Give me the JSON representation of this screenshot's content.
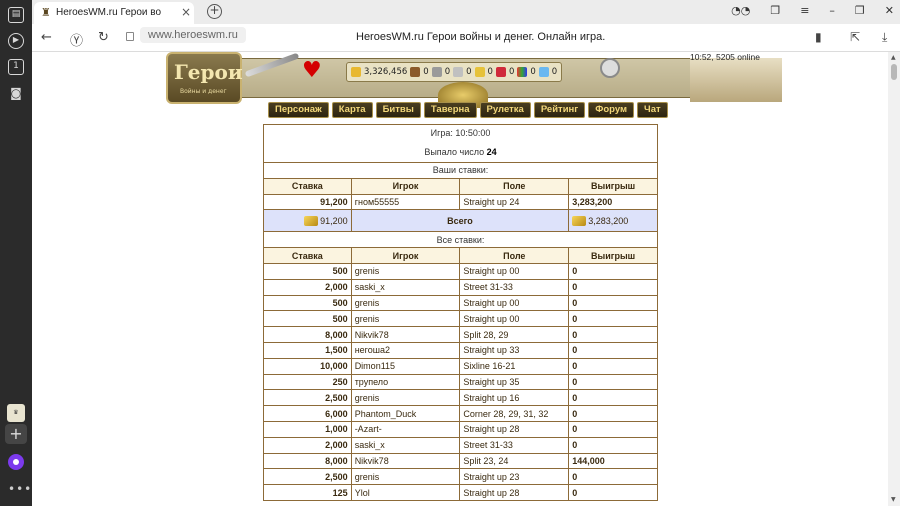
{
  "browser": {
    "tab_title": "HeroesWM.ru Герои во",
    "url": "www.heroeswm.ru",
    "page_title": "HeroesWM.ru Герои войны и денег. Онлайн игра."
  },
  "sidebar": {
    "tab_count": "1"
  },
  "header": {
    "logo_text": "Герои",
    "logo_sub": "Войны и денег",
    "gold": "3,326,456",
    "resources": [
      "0",
      "0",
      "0",
      "0",
      "0",
      "0",
      "0"
    ],
    "time_online": "10:52, 5205 online",
    "nav": [
      "Персонаж",
      "Карта",
      "Битвы",
      "Таверна",
      "Рулетка",
      "Рейтинг",
      "Форум",
      "Чат"
    ]
  },
  "game": {
    "game_label": "Игра: 10:50:00",
    "dropped_prefix": "Выпало число",
    "dropped_number": "24",
    "your_bets_caption": "Ваши ставки:",
    "all_bets_caption": "Все ставки:",
    "columns": [
      "Ставка",
      "Игрок",
      "Поле",
      "Выигрыш"
    ],
    "your_bets": [
      {
        "stake": "91,200",
        "player": "гном55555",
        "field": "Straight up 24",
        "win": "3,283,200"
      }
    ],
    "total": {
      "stake": "91,200",
      "label": "Всего",
      "win": "3,283,200"
    },
    "all_bets": [
      {
        "stake": "500",
        "player": "grenis",
        "field": "Straight up 00",
        "win": "0"
      },
      {
        "stake": "2,000",
        "player": "saski_x",
        "field": "Street 31-33",
        "win": "0"
      },
      {
        "stake": "500",
        "player": "grenis",
        "field": "Straight up 00",
        "win": "0"
      },
      {
        "stake": "500",
        "player": "grenis",
        "field": "Straight up 00",
        "win": "0"
      },
      {
        "stake": "8,000",
        "player": "Nikvik78",
        "field": "Split 28, 29",
        "win": "0"
      },
      {
        "stake": "1,500",
        "player": "негоша2",
        "field": "Straight up 33",
        "win": "0"
      },
      {
        "stake": "10,000",
        "player": "Dimon115",
        "field": "Sixline 16-21",
        "win": "0"
      },
      {
        "stake": "250",
        "player": "трупело",
        "field": "Straight up 35",
        "win": "0"
      },
      {
        "stake": "2,500",
        "player": "grenis",
        "field": "Straight up 16",
        "win": "0"
      },
      {
        "stake": "6,000",
        "player": "Phantom_Duck",
        "field": "Corner 28, 29, 31, 32",
        "win": "0"
      },
      {
        "stake": "1,000",
        "player": "-Azart-",
        "field": "Straight up 28",
        "win": "0"
      },
      {
        "stake": "2,000",
        "player": "saski_x",
        "field": "Street 31-33",
        "win": "0"
      },
      {
        "stake": "8,000",
        "player": "Nikvik78",
        "field": "Split 23, 24",
        "win": "144,000"
      },
      {
        "stake": "2,500",
        "player": "grenis",
        "field": "Straight up 23",
        "win": "0"
      },
      {
        "stake": "125",
        "player": "Ylol",
        "field": "Straight up 28",
        "win": "0"
      }
    ]
  }
}
